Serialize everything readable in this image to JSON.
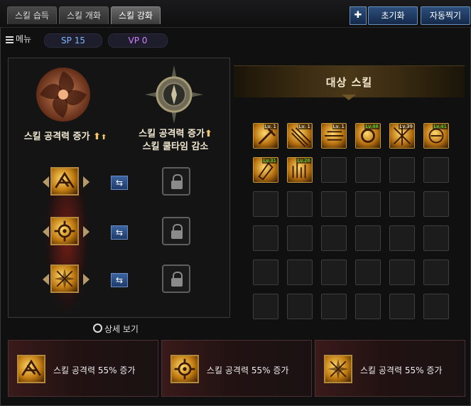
{
  "tabs": [
    {
      "label": "스킬 습득",
      "active": false
    },
    {
      "label": "스킬 개화",
      "active": false
    },
    {
      "label": "스킬 강화",
      "active": true
    }
  ],
  "toolbar": {
    "pin_glyph": "✚",
    "reset_label": "초기화",
    "auto_label": "자동찍기"
  },
  "menu": {
    "label": "메뉴",
    "sp": "SP 15",
    "vp": "VP 0"
  },
  "left_panel": {
    "title1": "스킬 공격력 증가",
    "title2_line1": "스킬 공격력 증가",
    "title2_line2": "스킬 쿨타임 감소",
    "detail_label": "상세 보기"
  },
  "slots": [
    {
      "icon": "blade-burst-icon",
      "locked": true
    },
    {
      "icon": "gear-burst-icon",
      "locked": true
    },
    {
      "icon": "star-burst-icon",
      "locked": true
    }
  ],
  "target": {
    "title": "대상 스킬",
    "skills": [
      {
        "level": "Lv. 1",
        "highlight": false
      },
      {
        "level": "Lv. 1",
        "highlight": false
      },
      {
        "level": "Lv. 1",
        "highlight": false
      },
      {
        "level": "Lv.48",
        "highlight": true
      },
      {
        "level": "Lv.39",
        "highlight": false
      },
      {
        "level": "Lv.41",
        "highlight": true
      },
      {
        "level": "Lv.31",
        "highlight": true
      },
      {
        "level": "Lv.26",
        "highlight": true
      }
    ],
    "empty_count": 28
  },
  "cards": [
    {
      "text": "스킬 공격력 55% 증가"
    },
    {
      "text": "스킬 공격력 55% 증가"
    },
    {
      "text": "스킬 공격력 55% 증가"
    }
  ],
  "colors": {
    "gold": "#f3c56a",
    "blue": "#2d4f7c",
    "level_green": "#4cff3c"
  }
}
